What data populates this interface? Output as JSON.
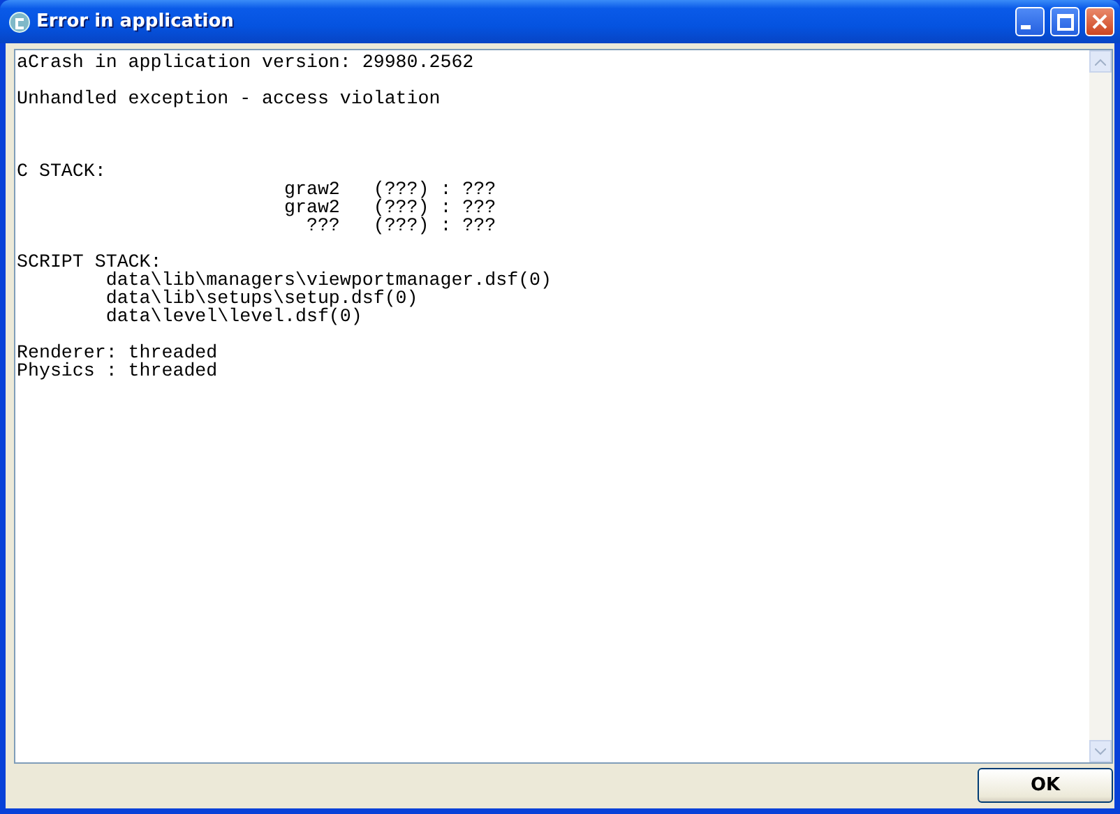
{
  "window": {
    "title": "Error in application"
  },
  "log": [
    {
      "kind": "text",
      "text": "aCrash in application version: 29980.2562"
    },
    {
      "kind": "blank"
    },
    {
      "kind": "text",
      "text": "Unhandled exception - access violation"
    },
    {
      "kind": "blank"
    },
    {
      "kind": "blank"
    },
    {
      "kind": "blank"
    },
    {
      "kind": "text",
      "text": "C STACK:"
    },
    {
      "kind": "text",
      "text": "                        graw2   (???) : ???"
    },
    {
      "kind": "text",
      "text": "                        graw2   (???) : ???"
    },
    {
      "kind": "text",
      "text": "                          ???   (???) : ???"
    },
    {
      "kind": "blank"
    },
    {
      "kind": "text",
      "text": "SCRIPT STACK:"
    },
    {
      "kind": "text",
      "text": "        data\\lib\\managers\\viewportmanager.dsf(0)"
    },
    {
      "kind": "text",
      "text": "        data\\lib\\setups\\setup.dsf(0)"
    },
    {
      "kind": "text",
      "text": "        data\\level\\level.dsf(0)"
    },
    {
      "kind": "blank"
    },
    {
      "kind": "text",
      "text": "Renderer: threaded"
    },
    {
      "kind": "text",
      "text": "Physics : threaded"
    }
  ],
  "buttons": [
    {
      "label": "OK"
    }
  ]
}
